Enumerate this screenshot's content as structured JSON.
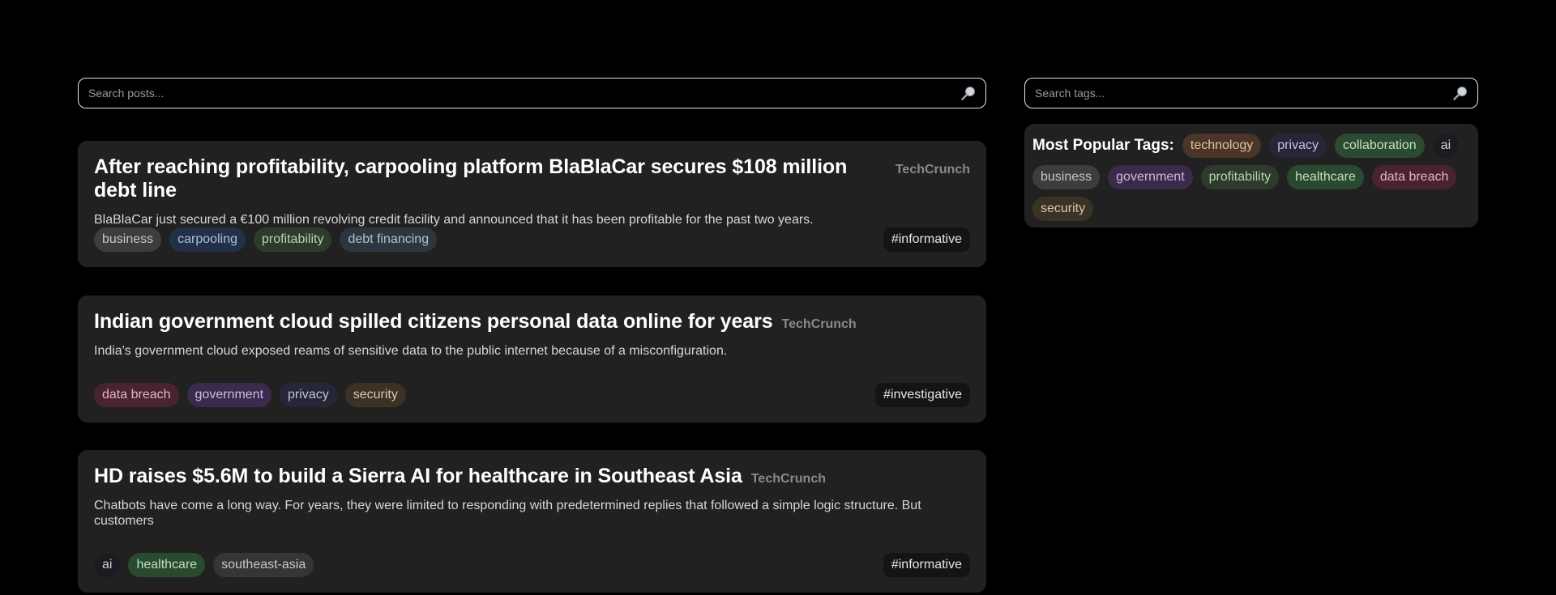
{
  "post_search": {
    "placeholder": "Search posts..."
  },
  "tag_search": {
    "placeholder": "Search tags..."
  },
  "posts": [
    {
      "title": "After reaching profitability, carpooling platform BlaBlaCar secures $108 million debt line",
      "source": "TechCrunch",
      "description": "BlaBlaCar just secured a €100 million revolving credit facility and announced that it has been profitable for the past two years.",
      "tags": [
        "business",
        "carpooling",
        "profitability",
        "debt financing"
      ],
      "hashtag": "#informative"
    },
    {
      "title": "Indian government cloud spilled citizens personal data online for years",
      "source": "TechCrunch",
      "description": "India's government cloud exposed reams of sensitive data to the public internet because of a misconfiguration.",
      "tags": [
        "data breach",
        "government",
        "privacy",
        "security"
      ],
      "hashtag": "#investigative"
    },
    {
      "title": "HD raises $5.6M to build a Sierra AI for healthcare in Southeast Asia",
      "source": "TechCrunch",
      "description": "Chatbots have come a long way. For years, they were limited to responding with predetermined replies that followed a simple logic structure. But customers",
      "tags": [
        "ai",
        "healthcare",
        "southeast-asia"
      ],
      "hashtag": "#informative"
    }
  ],
  "popular_tags": {
    "title": "Most Popular Tags:",
    "tags": [
      "technology",
      "privacy",
      "collaboration",
      "ai",
      "business",
      "government",
      "profitability",
      "healthcare",
      "data breach",
      "security"
    ]
  },
  "icons": {
    "search": "magnifying-glass-icon"
  }
}
